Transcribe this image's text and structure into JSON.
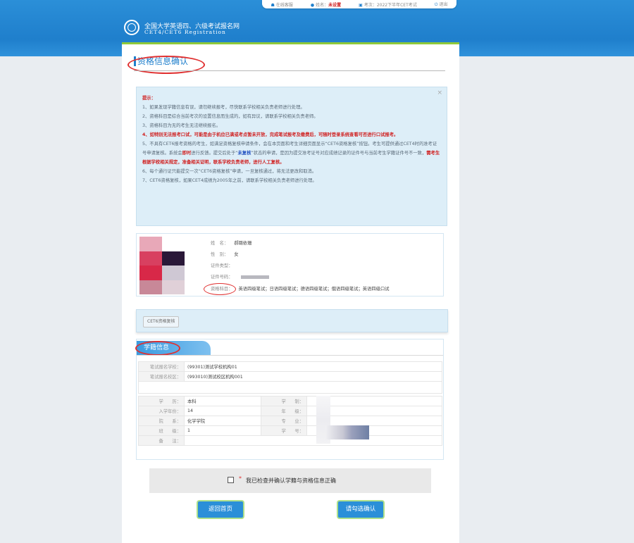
{
  "topbar": {
    "online": "在线客服",
    "name_label": "姓名：",
    "name_value": "未设置",
    "session": "考次：2022下半年CET考试",
    "logout": "退出"
  },
  "site": {
    "title": "全国大学英语四、六级考试报名网",
    "subtitle": "CET4/CET6  Registration"
  },
  "page": {
    "title": "资格信息确认"
  },
  "notice": {
    "heading": "提示：",
    "item1": "1、如果发现学籍信息有误，请勿继续报考，尽快联系学校相关负责老师进行处理。",
    "item2": "2、资格科目是综合当前考次的设置信息而生成的，如有异议，请联系学校相关负责老师。",
    "item3": "3、资格科目为无的考生无法继续报名。",
    "item4": "4、如特别无法报考口试，可能是由于机位已满或考点暂未开放，完成笔试报考及缴费后，可随时登录系统查看可否进行口试报考。",
    "item5_a": "5、不具有CET6报考资格的考生，如满足资格复核申请条件，会在本页面和考生详细页面显示“CET6资格复核”按钮。考生可提供通过CET4时的准考证号申请复核。系统会",
    "item5_b": "即时",
    "item5_c": "进行反馈。提交后处于“",
    "item5_d": "未复核",
    "item5_e": "”状态的申请，是因为提交准考证号对应成绩记录的证件号与当前考生学籍证件号不一致，",
    "item5_f": "需考生根据学校相关规定，准备相关证明，联系学校负责老师，进行人工复核。",
    "item6": "6、每个通行证只能提交一次“CET6资格复核”申请，一旦复核通过，将无法更改和取消。",
    "item7": "7、CET6资格复核，如果CET4成绩为2005年之前，请联系学校相关负责老师进行处理。"
  },
  "profile": {
    "name_label": "姓　名：",
    "name_value": "郝璐依珊",
    "gender_label": "性　别：",
    "gender_value": "女",
    "idtype_label": "证件类型：",
    "idno_label": "证件号码：",
    "subject_label": "资格科目：",
    "subject_value": "英语四级笔试；日语四级笔试；德语四级笔试；俄语四级笔试；英语四级口试"
  },
  "cet6": {
    "button": "CET6资格复核"
  },
  "school": {
    "tab": "学籍信息",
    "rows_top": [
      {
        "label": "笔试报名学校：",
        "value": "(99301)测试学校机构01"
      },
      {
        "label": "笔试报名校区：",
        "value": "(993010)测试校区机构001"
      }
    ],
    "rows": [
      {
        "l1": "学　　历：",
        "v1": "本科",
        "l2": "学　　制：",
        "v2": ""
      },
      {
        "l1": "入学年份：",
        "v1": "14",
        "l2": "年　　级：",
        "v2": ""
      },
      {
        "l1": "院　　系：",
        "v1": "化学学院",
        "l2": "专　　业：",
        "v2": ""
      },
      {
        "l1": "班　　级：",
        "v1": "1",
        "l2": "学　　号：",
        "v2": ""
      },
      {
        "l1": "备　　注：",
        "v1": "",
        "l2": "",
        "v2": ""
      }
    ]
  },
  "confirm": {
    "star": "*",
    "text": "我已检查并确认学籍与资格信息正确"
  },
  "buttons": {
    "back": "返回首页",
    "confirm": "请勾选确认"
  },
  "colors": {
    "brand_blue": "#1f7fcc",
    "accent_green": "#8fc93a",
    "alert_red": "#d02020"
  }
}
